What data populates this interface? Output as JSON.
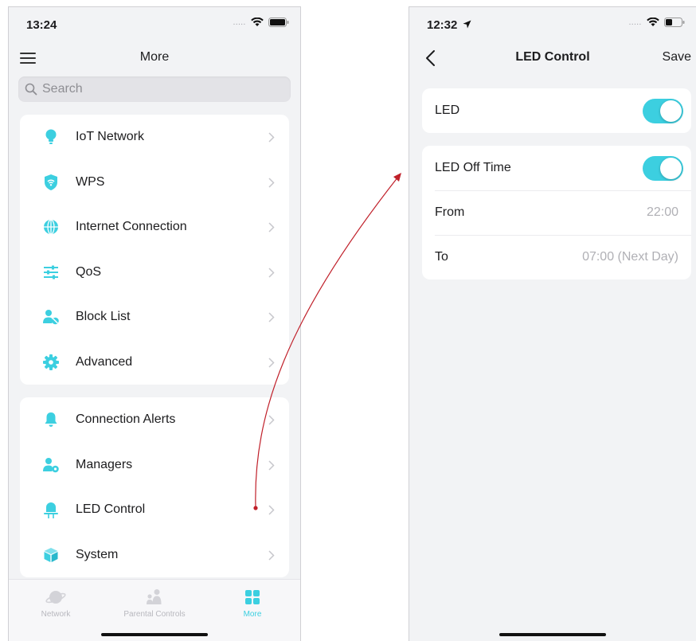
{
  "left_screen": {
    "status": {
      "time": "13:24",
      "signal": "....."
    },
    "nav": {
      "title": "More"
    },
    "search": {
      "placeholder": "Search"
    },
    "group1": [
      {
        "label": "IoT Network",
        "icon": "bulb-icon"
      },
      {
        "label": "WPS",
        "icon": "wps-shield-icon"
      },
      {
        "label": "Internet Connection",
        "icon": "globe-icon"
      },
      {
        "label": "QoS",
        "icon": "sliders-icon"
      },
      {
        "label": "Block List",
        "icon": "block-user-icon"
      },
      {
        "label": "Advanced",
        "icon": "gear-icon"
      }
    ],
    "group2": [
      {
        "label": "Connection Alerts",
        "icon": "bell-icon"
      },
      {
        "label": "Managers",
        "icon": "manager-user-icon"
      },
      {
        "label": "LED Control",
        "icon": "led-icon"
      },
      {
        "label": "System",
        "icon": "cube-icon"
      }
    ],
    "tabs": [
      {
        "label": "Network",
        "active": false
      },
      {
        "label": "Parental Controls",
        "active": false
      },
      {
        "label": "More",
        "active": true
      }
    ]
  },
  "right_screen": {
    "status": {
      "time": "12:32",
      "signal": "....."
    },
    "nav": {
      "title": "LED Control",
      "save": "Save"
    },
    "led": {
      "label": "LED",
      "enabled": true
    },
    "off_time": {
      "label": "LED Off Time",
      "enabled": true
    },
    "from": {
      "label": "From",
      "value": "22:00"
    },
    "to": {
      "label": "To",
      "value": "07:00 (Next Day)"
    }
  },
  "colors": {
    "accent": "#3ccfe0",
    "arrow": "#c0202a",
    "background": "#f2f3f5"
  }
}
